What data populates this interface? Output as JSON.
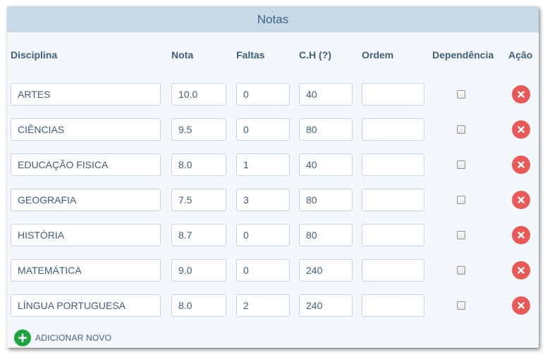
{
  "panel": {
    "title": "Notas"
  },
  "columns": {
    "disciplina": "Disciplina",
    "nota": "Nota",
    "faltas": "Faltas",
    "ch": "C.H (?)",
    "ordem": "Ordem",
    "dependencia": "Dependência",
    "acao": "Ação"
  },
  "rows": [
    {
      "disciplina": "ARTES",
      "nota": "10.0",
      "faltas": "0",
      "ch": "40",
      "ordem": "",
      "dependencia": false
    },
    {
      "disciplina": "CIÊNCIAS",
      "nota": "9.5",
      "faltas": "0",
      "ch": "80",
      "ordem": "",
      "dependencia": false
    },
    {
      "disciplina": "EDUCAÇÃO FISICA",
      "nota": "8.0",
      "faltas": "1",
      "ch": "40",
      "ordem": "",
      "dependencia": false
    },
    {
      "disciplina": "GEOGRAFIA",
      "nota": "7.5",
      "faltas": "3",
      "ch": "80",
      "ordem": "",
      "dependencia": false
    },
    {
      "disciplina": "HISTÓRIA",
      "nota": "8.7",
      "faltas": "0",
      "ch": "80",
      "ordem": "",
      "dependencia": false
    },
    {
      "disciplina": "MATEMÁTICA",
      "nota": "9.0",
      "faltas": "0",
      "ch": "240",
      "ordem": "",
      "dependencia": false
    },
    {
      "disciplina": "LÍNGUA PORTUGUESA",
      "nota": "8.0",
      "faltas": "2",
      "ch": "240",
      "ordem": "",
      "dependencia": false
    }
  ],
  "add_new": {
    "label": "ADICIONAR NOVO",
    "icon": "plus-circle-icon"
  },
  "row_action_icon": "close-icon",
  "colors": {
    "header_bg": "#c9dae7",
    "delete": "#e85a58",
    "add": "#1fa23f",
    "text": "#3f5e7b"
  }
}
